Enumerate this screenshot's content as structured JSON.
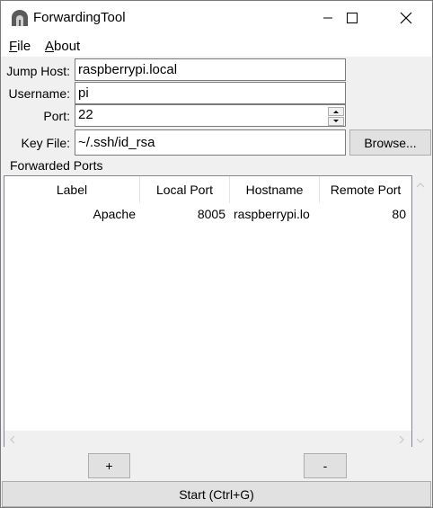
{
  "window": {
    "title": "ForwardingTool"
  },
  "menu": {
    "file": "File",
    "file_rest": "ile",
    "about": "About",
    "about_rest": "bout"
  },
  "form": {
    "jump_host_label": "Jump Host:",
    "jump_host_value": "raspberrypi.local",
    "username_label": "Username:",
    "username_value": "pi",
    "port_label": "Port:",
    "port_value": "22",
    "key_file_label": "Key File:",
    "key_file_value": "~/.ssh/id_rsa",
    "browse_label": "Browse..."
  },
  "ports": {
    "group_label": "Forwarded Ports",
    "columns": [
      "Label",
      "Local Port",
      "Hostname",
      "Remote Port"
    ],
    "rows": [
      {
        "label": "Apache",
        "local_port": "8005",
        "hostname": "raspberrypi.lo",
        "remote_port": "80"
      }
    ]
  },
  "buttons": {
    "add": "+",
    "remove": "-",
    "start": "Start (Ctrl+G)"
  },
  "colors": {
    "titlebar": "#ffffff",
    "window_bg": "#f0f0f0",
    "button_bg": "#e1e1e1"
  }
}
